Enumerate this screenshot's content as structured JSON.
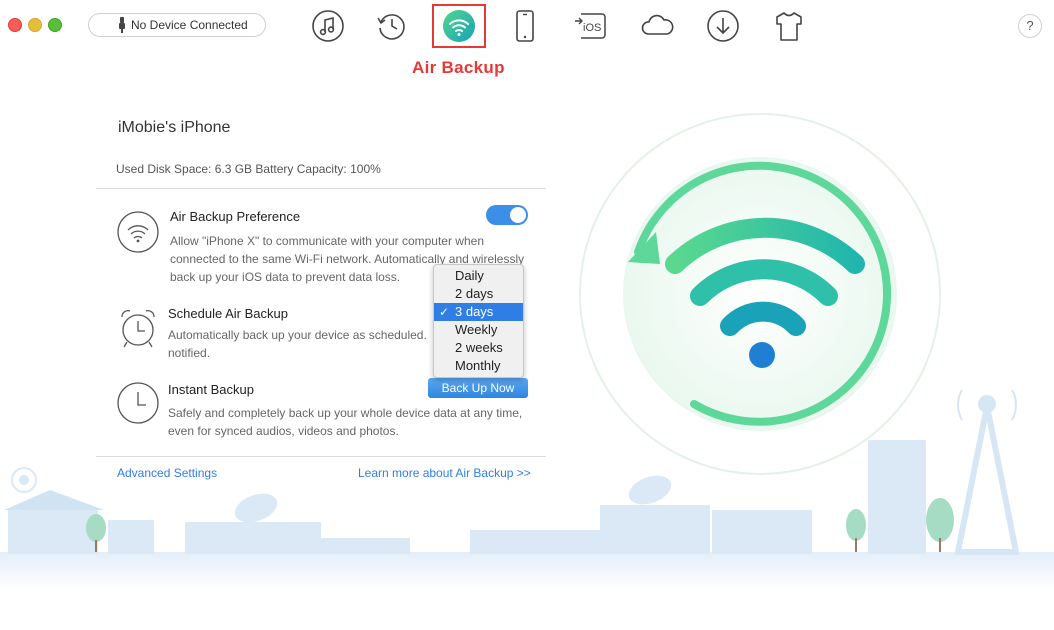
{
  "window": {
    "device_status": "No Device Connected",
    "help_label": "?"
  },
  "toolbar": {
    "items": [
      {
        "name": "music",
        "icon": "music-note-icon"
      },
      {
        "name": "history",
        "icon": "history-icon"
      },
      {
        "name": "air-backup",
        "icon": "wifi-icon"
      },
      {
        "name": "phone",
        "icon": "phone-icon"
      },
      {
        "name": "to-ios",
        "icon": "to-ios-icon"
      },
      {
        "name": "cloud",
        "icon": "cloud-icon"
      },
      {
        "name": "download",
        "icon": "download-icon"
      },
      {
        "name": "tshirt",
        "icon": "tshirt-icon"
      }
    ],
    "annotation": "Air Backup",
    "to_ios_text": "iOS"
  },
  "device": {
    "name": "iMobie's iPhone",
    "info": "Used Disk Space: 6.3 GB  Battery Capacity: 100%"
  },
  "options": {
    "preference": {
      "title": "Air Backup Preference",
      "desc": "Allow \"iPhone X\" to communicate with your computer when connected to the same Wi-Fi network. Automatically and wirelessly back up your iOS data to prevent data loss.",
      "enabled": true
    },
    "schedule": {
      "title": "Schedule Air Backup",
      "desc": "Automatically back up your device as scheduled. notified.",
      "options": [
        "Daily",
        "2 days",
        "3 days",
        "Weekly",
        "2 weeks",
        "Monthly"
      ],
      "selected": "3 days"
    },
    "instant": {
      "title": "Instant Backup",
      "desc": "Safely and completely back up your whole device data at any time, even for synced audios, videos and photos.",
      "button": "Back Up Now"
    }
  },
  "links": {
    "advanced": "Advanced Settings",
    "learn_more": "Learn more about Air Backup >>"
  },
  "colors": {
    "accent": "#2f7ee6",
    "highlight": "#e53935",
    "wifi_green": "#5ed79a",
    "wifi_teal": "#1aa3b8",
    "wifi_blue": "#1f7fd3"
  }
}
